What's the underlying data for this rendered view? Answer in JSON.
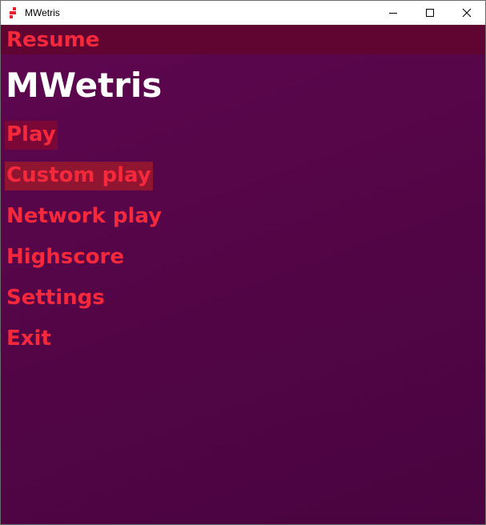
{
  "window": {
    "title": "MWetris",
    "icon": "mwetris-app-icon",
    "controls": [
      "minimize-icon",
      "maximize-icon",
      "close-icon"
    ]
  },
  "resume_label": "Resume",
  "game_title": "MWetris",
  "menu": {
    "items": [
      {
        "label": "Play",
        "state": "focused"
      },
      {
        "label": "Custom play",
        "state": "selected"
      },
      {
        "label": "Network play",
        "state": "normal"
      },
      {
        "label": "Highscore",
        "state": "normal"
      },
      {
        "label": "Settings",
        "state": "normal"
      },
      {
        "label": "Exit",
        "state": "normal"
      }
    ]
  },
  "colors": {
    "accent_text": "#f5283c",
    "background_top": "#5e0750",
    "background_bottom": "#4a0440",
    "resume_bar": "#600532",
    "title_text": "#ffffff"
  }
}
